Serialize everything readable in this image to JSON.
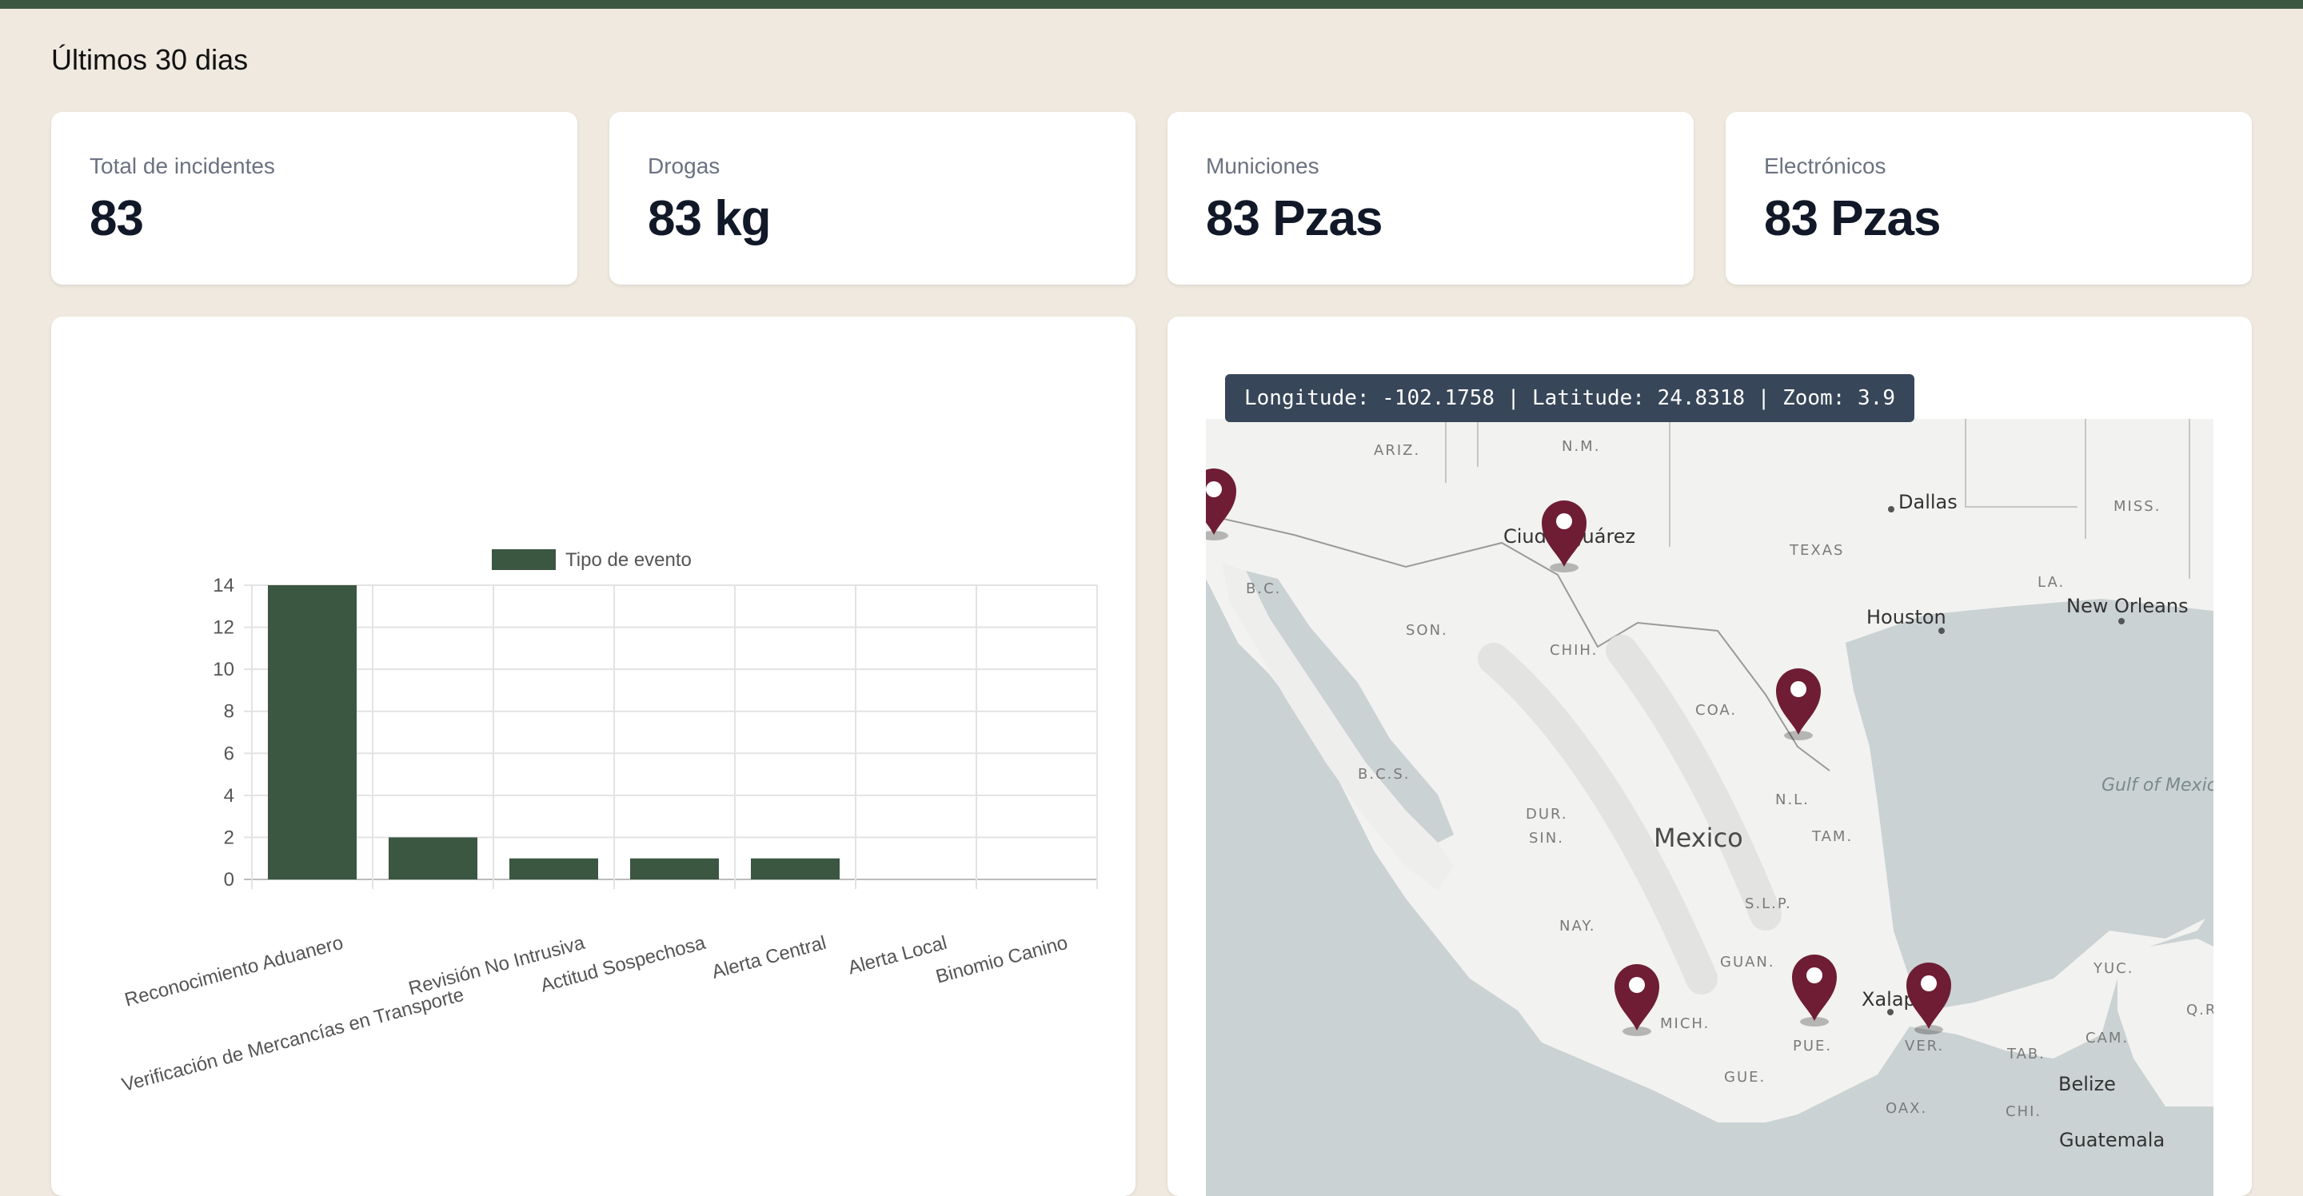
{
  "header": {
    "period_title": "Últimos 30 dias"
  },
  "stats": [
    {
      "label": "Total de incidentes",
      "value": "83"
    },
    {
      "label": "Drogas",
      "value": "83 kg"
    },
    {
      "label": "Municiones",
      "value": "83 Pzas"
    },
    {
      "label": "Electrónicos",
      "value": "83 Pzas"
    }
  ],
  "colors": {
    "accent": "#3b5641",
    "marker": "#6e1d35",
    "background": "#efe9df"
  },
  "chart_data": {
    "type": "bar",
    "legend": "Tipo de evento",
    "legend_position": "top",
    "grid": true,
    "categories": [
      "Reconocimiento Aduanero",
      "Verificación de Mercancías en Transporte",
      "Revisión No Intrusiva",
      "Actitud Sospechosa",
      "Alerta Central",
      "Alerta Local",
      "Binomio Canino"
    ],
    "series": [
      {
        "name": "Tipo de evento",
        "values": [
          14,
          2,
          1,
          1,
          1,
          0,
          0
        ]
      }
    ],
    "ylim": [
      0,
      14
    ],
    "yticks": [
      0,
      2,
      4,
      6,
      8,
      10,
      12,
      14
    ]
  },
  "map": {
    "coord_text": "Longitude: -102.1758 | Latitude: 24.8318 | Zoom: 3.9",
    "country_label": "Mexico",
    "cities": [
      "Dallas",
      "Houston",
      "New Orleans",
      "Ciudad Juárez",
      "Xalapa",
      "Belize",
      "Guatemala"
    ],
    "states": [
      "ARIZ.",
      "N.M.",
      "TEXAS",
      "MISS.",
      "LA.",
      "B.C.",
      "SON.",
      "CHIH.",
      "COA.",
      "B.C.S.",
      "DUR.",
      "N.L.",
      "SIN.",
      "TAM.",
      "S.L.P.",
      "NAY.",
      "GUAN.",
      "MICH.",
      "PUE.",
      "VER.",
      "GUE.",
      "OAX.",
      "TAB.",
      "CAM.",
      "YUC.",
      "Q.R.",
      "CHI."
    ],
    "water_label": "Gulf of Mexico",
    "marker_count": 6
  }
}
